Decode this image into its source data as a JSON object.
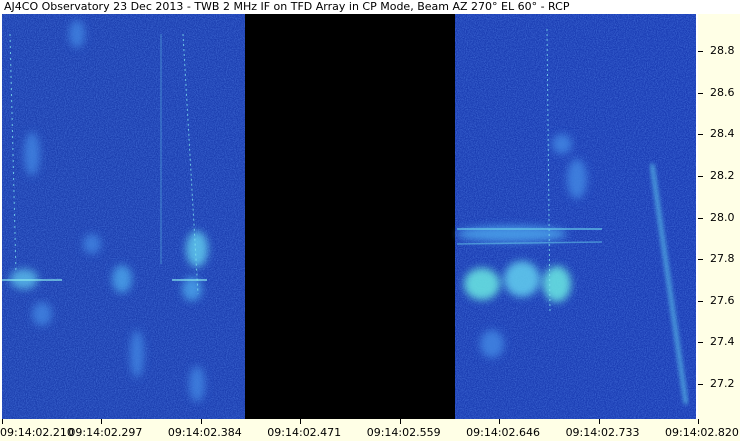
{
  "window": {
    "title": "AJ4CO Observatory 23 Dec 2013 - TWB 2 MHz IF on TFD Array in CP Mode, Beam AZ 270° EL 60° - RCP"
  },
  "chart_data": {
    "type": "heatmap",
    "title": "AJ4CO Observatory 23 Dec 2013 - TWB 2 MHz IF on TFD Array in CP Mode, Beam AZ 270° EL 60° - RCP",
    "x_tick_labels": [
      "09:14:02.210",
      "09:14:02.297",
      "09:14:02.384",
      "09:14:02.471",
      "09:14:02.559",
      "09:14:02.646",
      "09:14:02.733",
      "09:14:02.820"
    ],
    "y_tick_labels": [
      "28.8",
      "28.6",
      "28.4",
      "28.2",
      "28.0",
      "27.8",
      "27.6",
      "27.4",
      "27.2"
    ],
    "y_values": [
      28.8,
      28.6,
      28.4,
      28.2,
      28.0,
      27.8,
      27.6,
      27.4,
      27.2
    ],
    "ylim": [
      27.03,
      28.98
    ],
    "data_gap_x_range": [
      "09:14:02.422",
      "09:14:02.605"
    ],
    "colors": {
      "background_noise": "#1a3fb0",
      "gap": "#000000",
      "emission": "#5fe0e0",
      "axis_bg": "#ffffe6"
    }
  }
}
